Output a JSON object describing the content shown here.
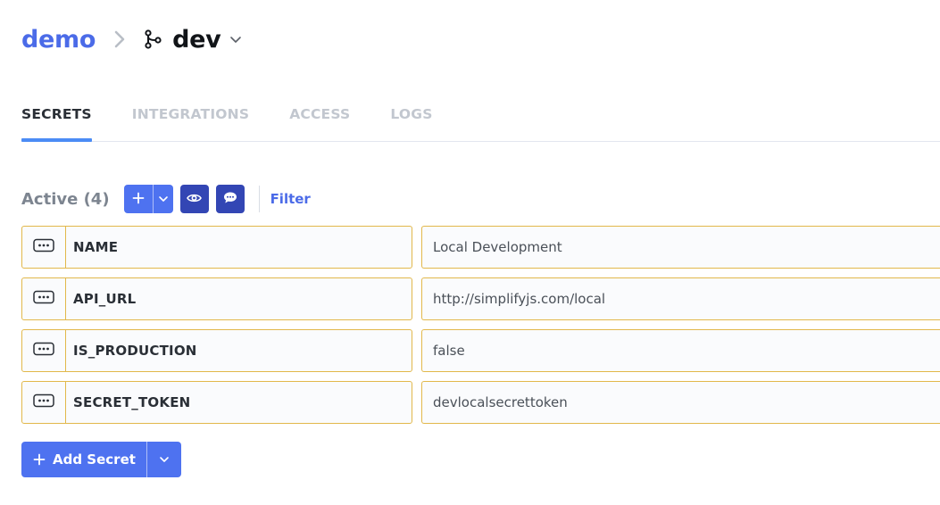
{
  "breadcrumb": {
    "project": "demo",
    "branch": "dev"
  },
  "tabs": [
    {
      "label": "SECRETS",
      "active": true
    },
    {
      "label": "INTEGRATIONS",
      "active": false
    },
    {
      "label": "ACCESS",
      "active": false
    },
    {
      "label": "LOGS",
      "active": false
    }
  ],
  "toolbar": {
    "active_label": "Active (4)",
    "filter_label": "Filter"
  },
  "secrets": [
    {
      "name": "NAME",
      "value": "Local Development"
    },
    {
      "name": "API_URL",
      "value": "http://simplifyjs.com/local"
    },
    {
      "name": "IS_PRODUCTION",
      "value": "false"
    },
    {
      "name": "SECRET_TOKEN",
      "value": "devlocalsecrettoken"
    }
  ],
  "add_button": {
    "label": "Add Secret"
  },
  "colors": {
    "accent": "#4e72f0",
    "accent_dark": "#3346b4",
    "project_link": "#4b6be8",
    "row_border": "#e2b84b",
    "tab_indicator": "#4b8cf5"
  },
  "icons": {
    "separator": "chevron-right-icon",
    "branch": "git-branch-icon",
    "branch_dropdown": "chevron-down-icon",
    "add": "plus-icon",
    "dropdown": "chevron-down-icon",
    "reveal": "eye-icon",
    "comments": "comment-icon",
    "row_menu": "more-horizontal-icon"
  }
}
